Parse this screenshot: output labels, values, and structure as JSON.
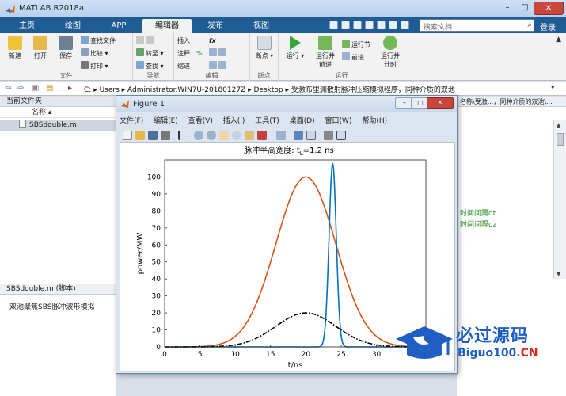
{
  "app": {
    "title": "MATLAB R2018a"
  },
  "window_controls": {
    "minimize": "–",
    "maximize": "□",
    "close": "✕"
  },
  "tabs": [
    "主页",
    "绘图",
    "APP",
    "编辑器",
    "发布",
    "视图"
  ],
  "active_tab": "编辑器",
  "search": {
    "placeholder": "搜索文档"
  },
  "login": "登录",
  "ribbon": {
    "file": {
      "name": "文件",
      "new": "新建",
      "open": "打开",
      "save": "保存",
      "find_files": "查找文件",
      "compare": "比较",
      "print": "打印"
    },
    "navigate": {
      "name": "导航",
      "goto": "转至",
      "find": "查找"
    },
    "edit": {
      "name": "编辑",
      "insert": "插入",
      "fx": "fx",
      "comment": "注释",
      "indent": "缩进"
    },
    "breakpoints": {
      "name": "断点",
      "bp": "断点"
    },
    "run": {
      "name": "运行",
      "run": "运行",
      "run_advance": "运行并\n前进",
      "run_section": "运行节",
      "advance": "前进",
      "run_time": "运行并\n计时"
    }
  },
  "address": {
    "segments": [
      "C:",
      "Users",
      "Administrator.WIN7U-20180127Z",
      "Desktop",
      "受激布里渊散射脉冲压缩模拟程序，同种介质的双池"
    ]
  },
  "current_folder": {
    "title": "当前文件夹",
    "column": "名称",
    "files": [
      "SBSdouble.m"
    ]
  },
  "details": {
    "title": "SBSdouble.m  (脚本)",
    "description": "双池聚焦SBS脉冲波形模拟"
  },
  "editor": {
    "tab": "名称\\受激...，同种介质的双池\\...",
    "comment1": "时间间隔dt",
    "comment2": "时间间隔dz"
  },
  "figure": {
    "title": "Figure 1",
    "menu": [
      "文件(F)",
      "编辑(E)",
      "查看(V)",
      "插入(I)",
      "工具(T)",
      "桌面(D)",
      "窗口(W)",
      "帮助(H)"
    ]
  },
  "chart_data": {
    "type": "line",
    "title": "脉冲半高宽度: t_L=1.2 ns",
    "title_prefix": "脉冲半高宽度: t",
    "title_sub": "L",
    "title_suffix": "=1.2 ns",
    "xlabel": "t/ns",
    "ylabel": "power/MW",
    "xlim": [
      0,
      37
    ],
    "ylim": [
      0,
      110
    ],
    "xticks": [
      0,
      5,
      10,
      15,
      20,
      25,
      30,
      35
    ],
    "yticks": [
      0,
      10,
      20,
      30,
      40,
      50,
      60,
      70,
      80,
      90,
      100
    ],
    "series": [
      {
        "kind": "gaussian",
        "center": 20,
        "peak": 100,
        "fwhm": 10,
        "color": "#d95319",
        "style": "solid"
      },
      {
        "kind": "gaussian",
        "center": 23.8,
        "peak": 108,
        "fwhm": 1.2,
        "color": "#0072bd",
        "style": "solid"
      },
      {
        "kind": "gaussian",
        "center": 20,
        "peak": 20,
        "fwhm": 10,
        "color": "#000000",
        "style": "dashdot"
      }
    ]
  },
  "watermark": {
    "cn": "必过源码",
    "en_main": "Biguo100.",
    "en_suffix": "CN"
  },
  "colors": {
    "tabbar": "#1f5c94",
    "accent": "#1f5fc4",
    "red": "#e1261c"
  }
}
